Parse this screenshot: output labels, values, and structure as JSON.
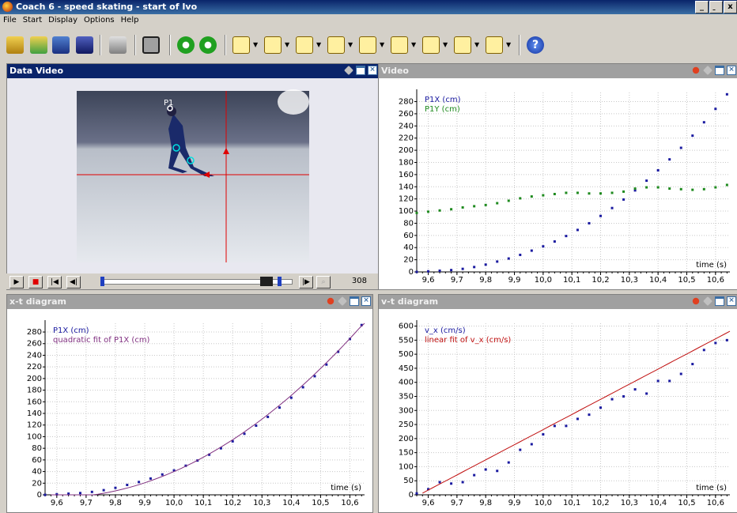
{
  "window": {
    "title": "Coach 6 - speed skating - start of Ivo",
    "min": "_",
    "restore": "̱",
    "close": "x"
  },
  "menu": [
    "File",
    "Start",
    "Display",
    "Options",
    "Help"
  ],
  "colors": {
    "p1x": "#1a1aa0",
    "p1y": "#1e8a1e",
    "fit": "#c01010",
    "quadfit": "#803080",
    "active_header": "#0a246a",
    "inactive_header": "#a0a0a0"
  },
  "icons": [
    "open-folder-icon",
    "open-activity-icon",
    "save-icon",
    "save-disk-icon",
    "print-icon",
    "film-icon",
    "start-icon",
    "stop-icon",
    "diagram-icon",
    "meter-icon",
    "graph-icon",
    "table-icon",
    "text-icon",
    "picture-icon",
    "video-icon",
    "sensor-icon",
    "note-icon",
    "help-icon"
  ],
  "panels": {
    "data_video": {
      "title": "Data Video",
      "frame": "308",
      "point_label": "P1"
    },
    "video": {
      "title": "Video"
    },
    "xt": {
      "title": "x-t diagram"
    },
    "vt": {
      "title": "v-t diagram"
    }
  },
  "chart_data": [
    {
      "type": "scatter",
      "panel": "video",
      "xlabel": "time (s)",
      "xlim": [
        9.56,
        10.65
      ],
      "ylim": [
        0,
        295
      ],
      "xticks": [
        "9,6",
        "9,7",
        "9,8",
        "9,9",
        "10,0",
        "10,1",
        "10,2",
        "10,3",
        "10,4",
        "10,5",
        "10,6"
      ],
      "yticks": [
        "0",
        "20",
        "40",
        "60",
        "80",
        "100",
        "120",
        "140",
        "160",
        "180",
        "200",
        "220",
        "240",
        "260",
        "280"
      ],
      "series": [
        {
          "name": "P1X (cm)",
          "color": "#1a1aa0",
          "x": [
            9.56,
            9.6,
            9.64,
            9.68,
            9.72,
            9.76,
            9.8,
            9.84,
            9.88,
            9.92,
            9.96,
            10.0,
            10.04,
            10.08,
            10.12,
            10.16,
            10.2,
            10.24,
            10.28,
            10.32,
            10.36,
            10.4,
            10.44,
            10.48,
            10.52,
            10.56,
            10.6,
            10.64
          ],
          "y": [
            0,
            1,
            2,
            3,
            5,
            8,
            12,
            17,
            22,
            28,
            35,
            42,
            50,
            59,
            69,
            80,
            92,
            105,
            119,
            134,
            150,
            167,
            185,
            204,
            224,
            246,
            268,
            292
          ]
        },
        {
          "name": "P1Y (cm)",
          "color": "#1e8a1e",
          "x": [
            9.56,
            9.6,
            9.64,
            9.68,
            9.72,
            9.76,
            9.8,
            9.84,
            9.88,
            9.92,
            9.96,
            10.0,
            10.04,
            10.08,
            10.12,
            10.16,
            10.2,
            10.24,
            10.28,
            10.32,
            10.36,
            10.4,
            10.44,
            10.48,
            10.52,
            10.56,
            10.6,
            10.64
          ],
          "y": [
            97,
            99,
            101,
            103,
            106,
            108,
            110,
            113,
            117,
            121,
            124,
            126,
            128,
            130,
            130,
            129,
            129,
            130,
            132,
            137,
            139,
            139,
            137,
            136,
            135,
            136,
            139,
            143
          ]
        }
      ]
    },
    {
      "type": "scatter",
      "panel": "xt",
      "xlabel": "time (s)",
      "xlim": [
        9.56,
        10.65
      ],
      "ylim": [
        0,
        295
      ],
      "xticks": [
        "9,6",
        "9,7",
        "9,8",
        "9,9",
        "10,0",
        "10,1",
        "10,2",
        "10,3",
        "10,4",
        "10,5",
        "10,6"
      ],
      "yticks": [
        "0",
        "20",
        "40",
        "60",
        "80",
        "100",
        "120",
        "140",
        "160",
        "180",
        "200",
        "220",
        "240",
        "260",
        "280"
      ],
      "series": [
        {
          "name": "P1X (cm)",
          "color": "#1a1aa0",
          "x": [
            9.56,
            9.6,
            9.64,
            9.68,
            9.72,
            9.76,
            9.8,
            9.84,
            9.88,
            9.92,
            9.96,
            10.0,
            10.04,
            10.08,
            10.12,
            10.16,
            10.2,
            10.24,
            10.28,
            10.32,
            10.36,
            10.4,
            10.44,
            10.48,
            10.52,
            10.56,
            10.6,
            10.64
          ],
          "y": [
            0,
            1,
            2,
            3,
            5,
            8,
            12,
            17,
            22,
            28,
            35,
            42,
            50,
            59,
            69,
            80,
            92,
            105,
            119,
            134,
            150,
            167,
            185,
            204,
            224,
            246,
            268,
            292
          ]
        },
        {
          "name": "quadratic fit of P1X (cm)",
          "color": "#803080",
          "fit": {
            "kind": "quadratic",
            "a": 269,
            "b": -5160,
            "c": 24740
          }
        }
      ]
    },
    {
      "type": "scatter",
      "panel": "vt",
      "xlabel": "time (s)",
      "xlim": [
        9.56,
        10.65
      ],
      "ylim": [
        0,
        610
      ],
      "xticks": [
        "9,6",
        "9,7",
        "9,8",
        "9,9",
        "10,0",
        "10,1",
        "10,2",
        "10,3",
        "10,4",
        "10,5",
        "10,6"
      ],
      "yticks": [
        "0",
        "50",
        "100",
        "150",
        "200",
        "250",
        "300",
        "350",
        "400",
        "450",
        "500",
        "550",
        "600"
      ],
      "series": [
        {
          "name": "v_x (cm/s)",
          "color": "#1a1aa0",
          "x": [
            9.56,
            9.6,
            9.64,
            9.68,
            9.72,
            9.76,
            9.8,
            9.84,
            9.88,
            9.92,
            9.96,
            10.0,
            10.04,
            10.08,
            10.12,
            10.16,
            10.2,
            10.24,
            10.28,
            10.32,
            10.36,
            10.4,
            10.44,
            10.48,
            10.52,
            10.56,
            10.6,
            10.64
          ],
          "y": [
            5,
            20,
            45,
            40,
            45,
            70,
            90,
            85,
            115,
            160,
            180,
            215,
            245,
            245,
            270,
            285,
            310,
            340,
            350,
            375,
            360,
            405,
            405,
            430,
            465,
            515,
            540,
            550
          ]
        },
        {
          "name": "linear fit of v_x (cm/s)",
          "color": "#c01010",
          "fit": {
            "kind": "linear",
            "a": 538,
            "b": -5148
          }
        }
      ]
    }
  ]
}
